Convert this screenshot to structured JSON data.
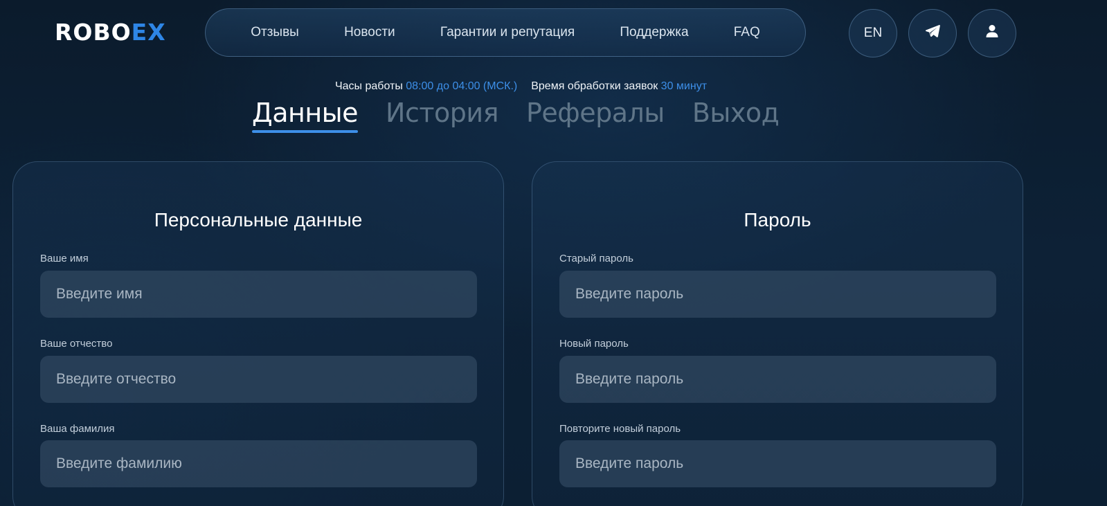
{
  "brand": {
    "part1": "ROBO",
    "part2": "EX"
  },
  "nav": {
    "items": [
      "Отзывы",
      "Новости",
      "Гарантии и репутация",
      "Поддержка",
      "FAQ"
    ]
  },
  "header_buttons": {
    "language": "EN",
    "telegram_icon": "telegram-icon",
    "user_icon": "user-icon"
  },
  "info": {
    "hours_label": "Часы работы",
    "hours_value": "08:00 до 04:00 (МСК.)",
    "processing_label": "Время обработки заявок",
    "processing_value": "30 минут"
  },
  "tabs": [
    {
      "label": "Данные",
      "active": true
    },
    {
      "label": "История",
      "active": false
    },
    {
      "label": "Рефералы",
      "active": false
    },
    {
      "label": "Выход",
      "active": false
    }
  ],
  "personal": {
    "title": "Персональные данные",
    "fields": [
      {
        "label": "Ваше имя",
        "placeholder": "Введите имя",
        "value": ""
      },
      {
        "label": "Ваше отчество",
        "placeholder": "Введите отчество",
        "value": ""
      },
      {
        "label": "Ваша фамилия",
        "placeholder": "Введите фамилию",
        "value": ""
      }
    ]
  },
  "password": {
    "title": "Пароль",
    "fields": [
      {
        "label": "Старый пароль",
        "placeholder": "Введите пароль",
        "value": ""
      },
      {
        "label": "Новый пароль",
        "placeholder": "Введите пароль",
        "value": ""
      },
      {
        "label": "Повторите новый пароль",
        "placeholder": "Введите пароль",
        "value": ""
      }
    ]
  },
  "colors": {
    "accent": "#3d8fe8",
    "background": "#0d2136",
    "tab_inactive": "#5f7588"
  }
}
